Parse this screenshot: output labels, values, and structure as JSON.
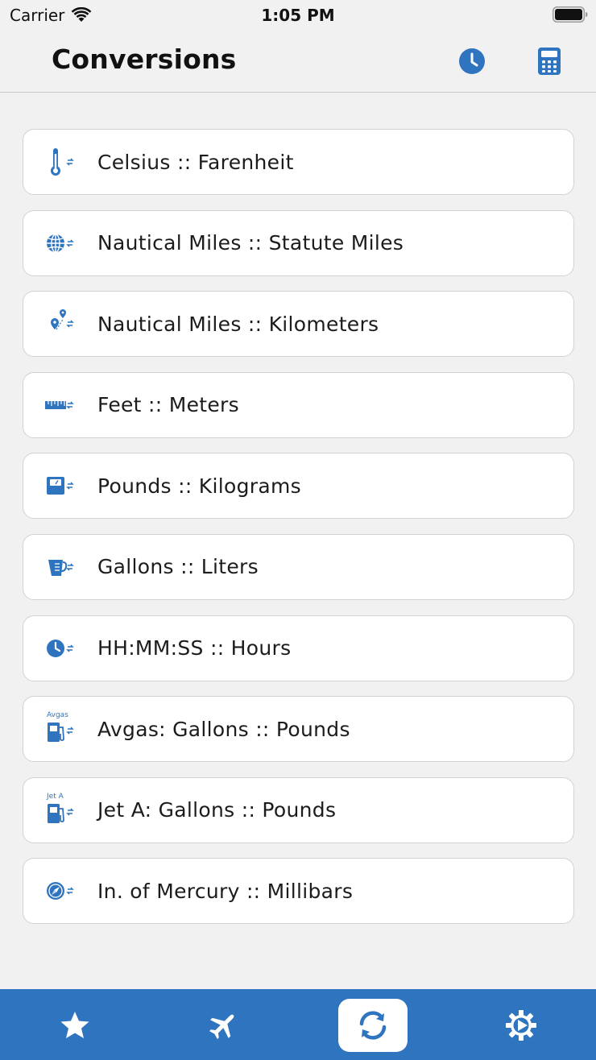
{
  "status_bar": {
    "carrier": "Carrier",
    "time": "1:05 PM"
  },
  "nav": {
    "title": "Conversions",
    "history_icon": "clock-icon",
    "calculator_icon": "calculator-icon"
  },
  "colors": {
    "accent": "#2f74bf",
    "background": "#f1f1f2",
    "card": "#ffffff"
  },
  "conversions": [
    {
      "label": "Celsius :: Farenheit",
      "icon": "thermometer-icon"
    },
    {
      "label": "Nautical Miles :: Statute Miles",
      "icon": "globe-icon"
    },
    {
      "label": "Nautical Miles :: Kilometers",
      "icon": "route-pins-icon"
    },
    {
      "label": "Feet :: Meters",
      "icon": "ruler-icon"
    },
    {
      "label": "Pounds :: Kilograms",
      "icon": "scale-icon"
    },
    {
      "label": "Gallons :: Liters",
      "icon": "measuring-cup-icon"
    },
    {
      "label": "HH:MM:SS :: Hours",
      "icon": "clock-icon"
    },
    {
      "label": "Avgas: Gallons :: Pounds",
      "icon": "fuel-pump-icon",
      "icon_caption": "Avgas"
    },
    {
      "label": "Jet A: Gallons :: Pounds",
      "icon": "fuel-pump-icon",
      "icon_caption": "Jet A"
    },
    {
      "label": "In. of Mercury :: Millibars",
      "icon": "compass-gauge-icon"
    }
  ],
  "tabs": [
    {
      "name": "favorites",
      "icon": "star-icon",
      "active": false
    },
    {
      "name": "flight",
      "icon": "airplane-icon",
      "active": false
    },
    {
      "name": "conversions",
      "icon": "sync-arrows-icon",
      "active": true
    },
    {
      "name": "settings",
      "icon": "gear-icon",
      "active": false
    }
  ]
}
